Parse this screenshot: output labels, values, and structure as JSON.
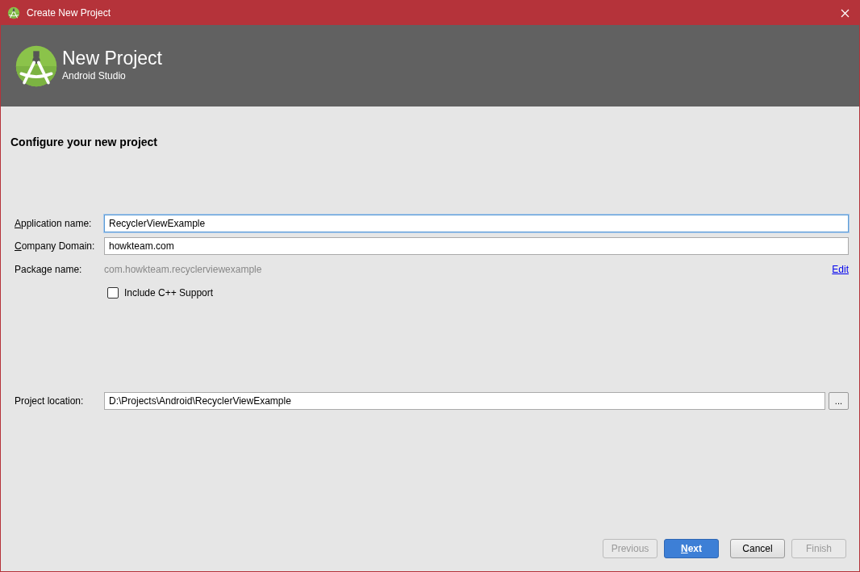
{
  "window": {
    "title": "Create New Project"
  },
  "header": {
    "title": "New Project",
    "subtitle": "Android Studio"
  },
  "section_title": "Configure your new project",
  "fields": [
    {
      "label": "Application name:",
      "mnemonic": true,
      "value": "RecyclerViewExample",
      "focused": true
    },
    {
      "label": "Company Domain:",
      "mnemonic": true,
      "value": "howkteam.com",
      "focused": false
    }
  ],
  "package": {
    "label": "Package name:",
    "value": "com.howkteam.recyclerviewexample",
    "link": "Edit"
  },
  "checkbox": {
    "label": "Include C++ Support",
    "checked": false
  },
  "location": {
    "label": "Project location:",
    "value": "D:\\Projects\\Android\\RecyclerViewExample",
    "browse": "..."
  },
  "buttons": [
    {
      "label": "Previous",
      "kind": "default",
      "disabled": true,
      "mnemonic": false
    },
    {
      "label": "Next",
      "kind": "primary",
      "disabled": false,
      "mnemonic": true
    },
    {
      "label": "Cancel",
      "kind": "default",
      "disabled": false,
      "mnemonic": false
    },
    {
      "label": "Finish",
      "kind": "default",
      "disabled": true,
      "mnemonic": false
    }
  ]
}
